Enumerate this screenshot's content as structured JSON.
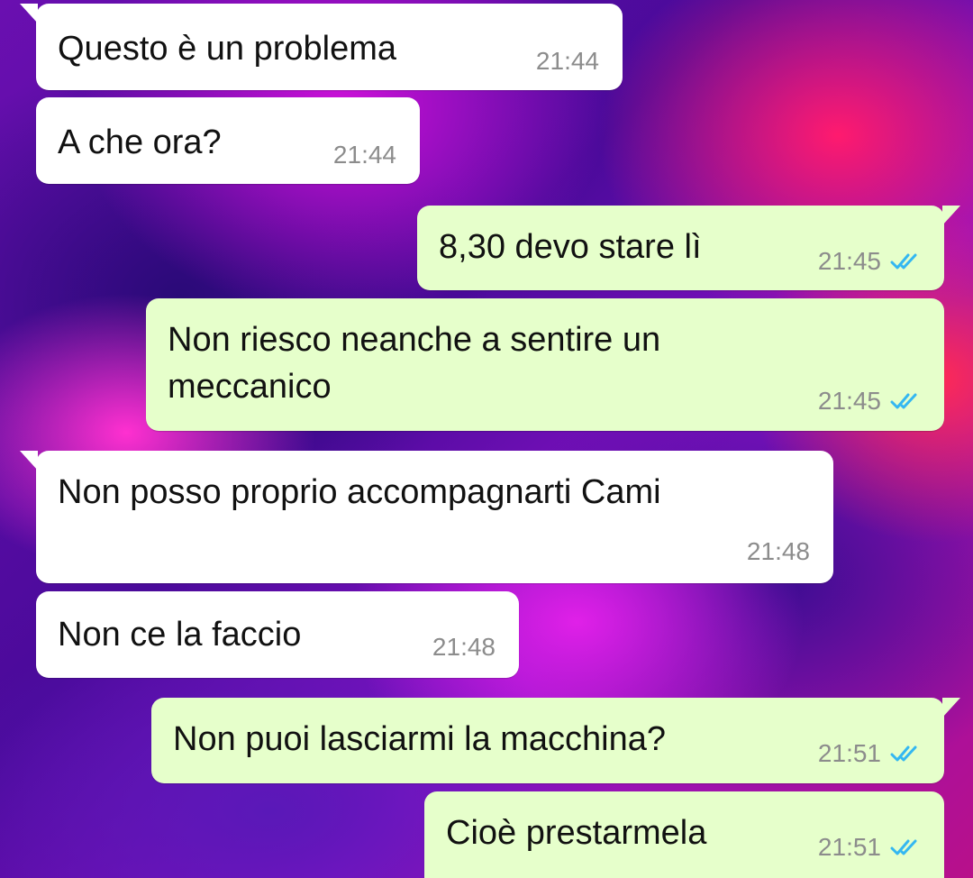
{
  "messages": [
    {
      "direction": "incoming",
      "text": "Questo è un problema",
      "time": "21:44"
    },
    {
      "direction": "incoming",
      "text": "A che ora?",
      "time": "21:44"
    },
    {
      "direction": "outgoing",
      "text": "8,30 devo stare lì",
      "time": "21:45",
      "status": "read"
    },
    {
      "direction": "outgoing",
      "text_lines": [
        "Non riesco neanche a sentire un",
        "meccanico"
      ],
      "time": "21:45",
      "status": "read"
    },
    {
      "direction": "incoming",
      "text": "Non posso proprio accompagnarti Cami",
      "time": "21:48"
    },
    {
      "direction": "incoming",
      "text": "Non ce la faccio",
      "time": "21:48"
    },
    {
      "direction": "outgoing",
      "text": "Non puoi lasciarmi la macchina?",
      "time": "21:51",
      "status": "read"
    },
    {
      "direction": "outgoing",
      "text": "Cioè prestarmela",
      "time": "21:51",
      "status": "read"
    }
  ],
  "colors": {
    "incoming_bubble": "#ffffff",
    "outgoing_bubble": "#e6ffcb",
    "read_ticks": "#34b7f1",
    "timestamp": "#8c8c8c"
  },
  "icons": {
    "read_status": "double-check-icon"
  }
}
